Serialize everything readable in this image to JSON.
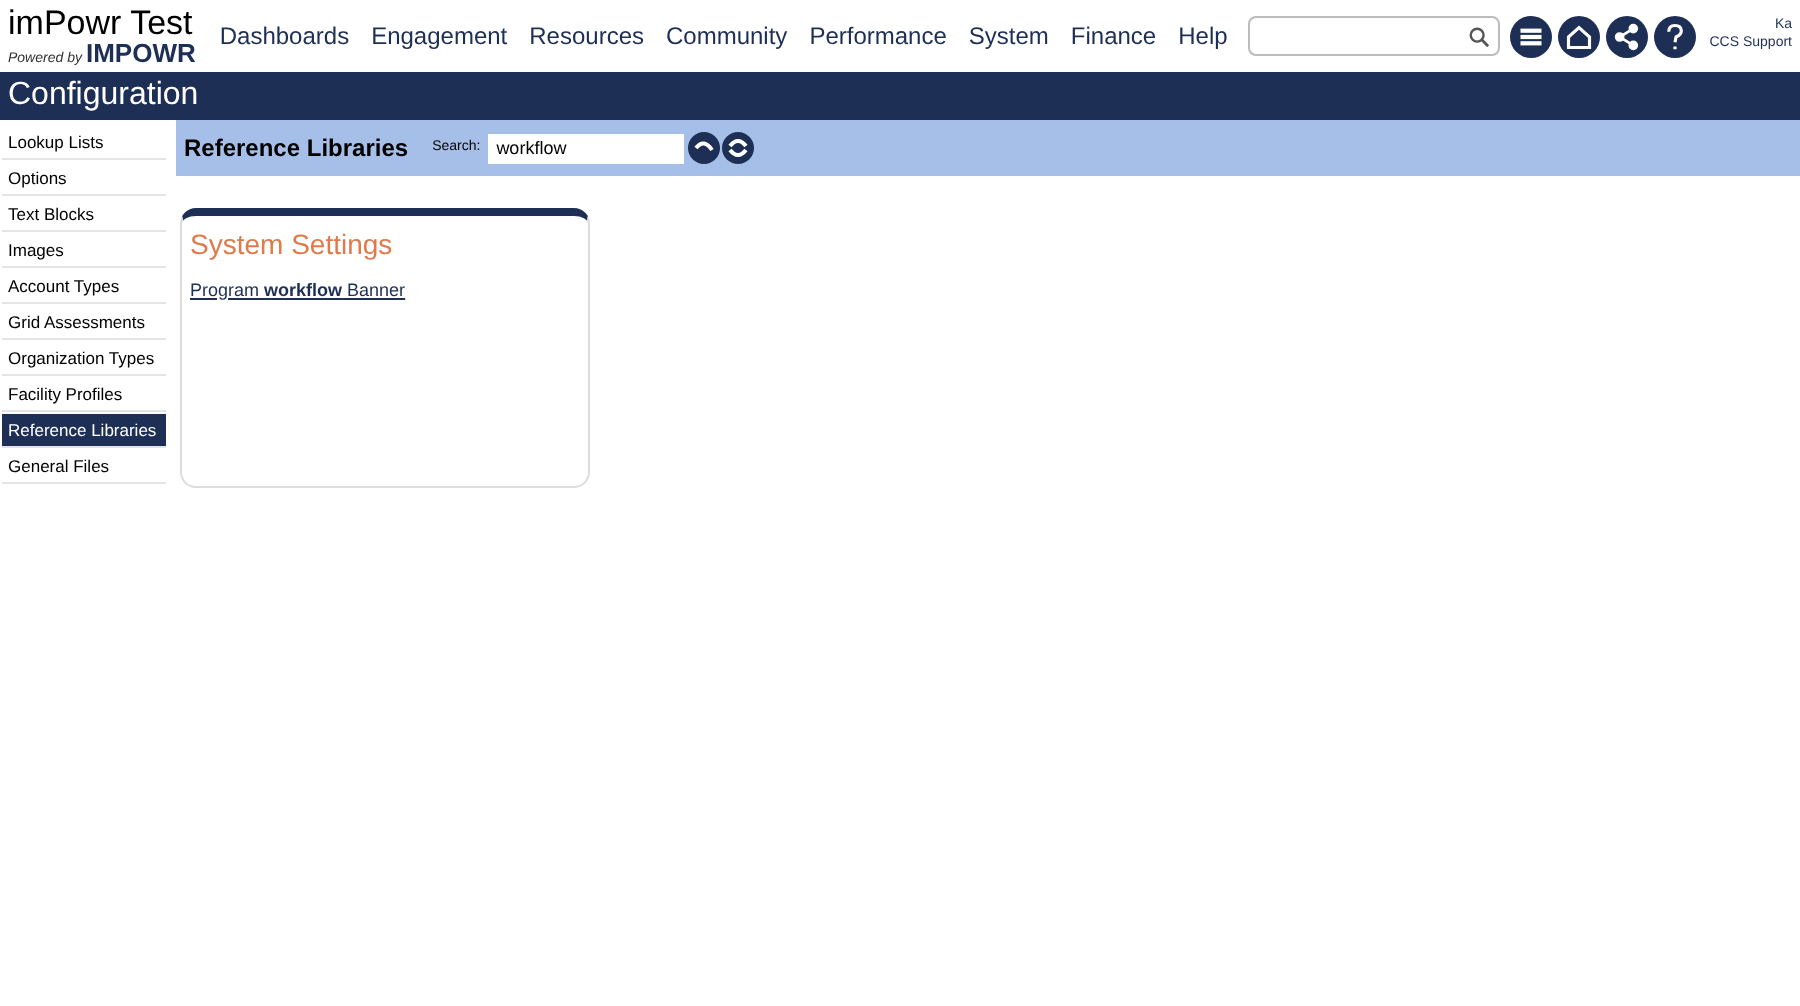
{
  "brand": {
    "title": "imPowr Test",
    "powered_by": "Powered by",
    "logo": "IMPOWR"
  },
  "nav": [
    "Dashboards",
    "Engagement",
    "Resources",
    "Community",
    "Performance",
    "System",
    "Finance",
    "Help"
  ],
  "user": {
    "name": "Ka",
    "role": "CCS Support"
  },
  "header": {
    "title": "Configuration"
  },
  "sidebar": {
    "items": [
      {
        "label": "Lookup Lists",
        "selected": false
      },
      {
        "label": "Options",
        "selected": false
      },
      {
        "label": "Text Blocks",
        "selected": false
      },
      {
        "label": "Images",
        "selected": false
      },
      {
        "label": "Account Types",
        "selected": false
      },
      {
        "label": "Grid Assessments",
        "selected": false
      },
      {
        "label": "Organization Types",
        "selected": false
      },
      {
        "label": "Facility Profiles",
        "selected": false
      },
      {
        "label": "Reference Libraries",
        "selected": true
      },
      {
        "label": "General Files",
        "selected": false
      }
    ]
  },
  "toolbar": {
    "title": "Reference Libraries",
    "search_label": "Search:",
    "search_value": "workflow"
  },
  "results": [
    {
      "title": "System Settings",
      "link": "Program **workflow** Banner"
    }
  ]
}
